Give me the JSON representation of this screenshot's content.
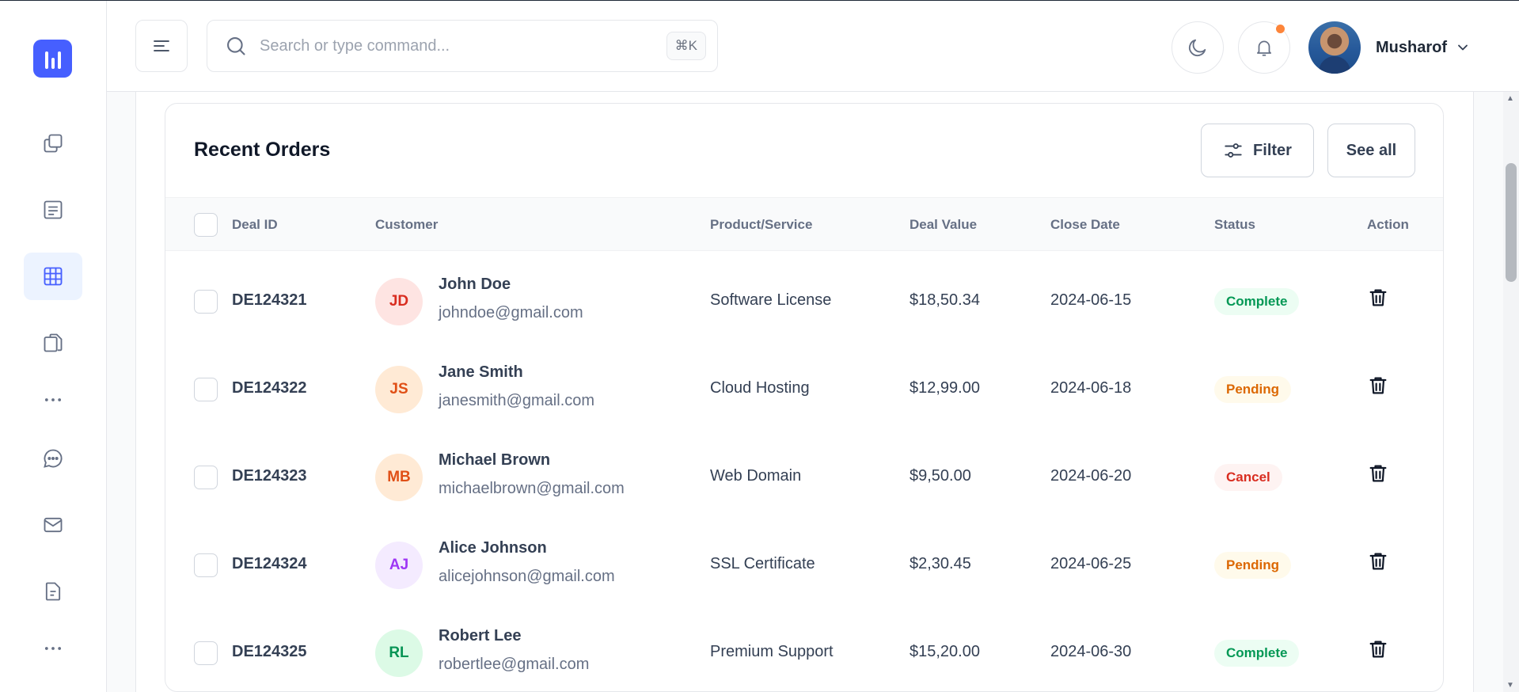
{
  "header": {
    "search": {
      "placeholder": "Search or type command...",
      "shortcut": "⌘K"
    },
    "user": {
      "name": "Musharof"
    },
    "notification_dot_color": "#fd853a"
  },
  "sidebar": {
    "accent_color": "#465fff",
    "items": [
      {
        "icon": "copy-icon",
        "active": false
      },
      {
        "icon": "document-icon",
        "active": false
      },
      {
        "icon": "table-icon",
        "active": true
      },
      {
        "icon": "pages-icon",
        "active": false
      },
      {
        "icon": "more-dots-icon",
        "active": false
      },
      {
        "icon": "chat-icon",
        "active": false
      },
      {
        "icon": "mail-icon",
        "active": false
      },
      {
        "icon": "invoice-icon",
        "active": false
      },
      {
        "icon": "more-dots-icon",
        "active": false
      }
    ]
  },
  "card": {
    "title": "Recent Orders",
    "filter_label": "Filter",
    "see_all_label": "See all",
    "columns": [
      "Deal ID",
      "Customer",
      "Product/Service",
      "Deal Value",
      "Close Date",
      "Status",
      "Action"
    ],
    "rows": [
      {
        "deal_id": "DE124321",
        "initials": "JD",
        "name": "John Doe",
        "email": "johndoe@gmail.com",
        "product": "Software License",
        "value": "$18,50.34",
        "date": "2024-06-15",
        "status": "Complete",
        "avatar_bg": "#fee4e2",
        "avatar_fg": "#d92d20"
      },
      {
        "deal_id": "DE124322",
        "initials": "JS",
        "name": "Jane Smith",
        "email": "janesmith@gmail.com",
        "product": "Cloud Hosting",
        "value": "$12,99.00",
        "date": "2024-06-18",
        "status": "Pending",
        "avatar_bg": "#ffead5",
        "avatar_fg": "#e04f16"
      },
      {
        "deal_id": "DE124323",
        "initials": "MB",
        "name": "Michael Brown",
        "email": "michaelbrown@gmail.com",
        "product": "Web Domain",
        "value": "$9,50.00",
        "date": "2024-06-20",
        "status": "Cancel",
        "avatar_bg": "#ffead5",
        "avatar_fg": "#e04f16"
      },
      {
        "deal_id": "DE124324",
        "initials": "AJ",
        "name": "Alice Johnson",
        "email": "alicejohnson@gmail.com",
        "product": "SSL Certificate",
        "value": "$2,30.45",
        "date": "2024-06-25",
        "status": "Pending",
        "avatar_bg": "#f4ebff",
        "avatar_fg": "#9e36f5"
      },
      {
        "deal_id": "DE124325",
        "initials": "RL",
        "name": "Robert Lee",
        "email": "robertlee@gmail.com",
        "product": "Premium Support",
        "value": "$15,20.00",
        "date": "2024-06-30",
        "status": "Complete",
        "avatar_bg": "#dcfae6",
        "avatar_fg": "#079455"
      }
    ],
    "status_colors": {
      "Complete": {
        "bg": "#ecfdf3",
        "fg": "#039855"
      },
      "Pending": {
        "bg": "#fffaeb",
        "fg": "#dc6803"
      },
      "Cancel": {
        "bg": "#fef3f2",
        "fg": "#d92d20"
      }
    }
  }
}
